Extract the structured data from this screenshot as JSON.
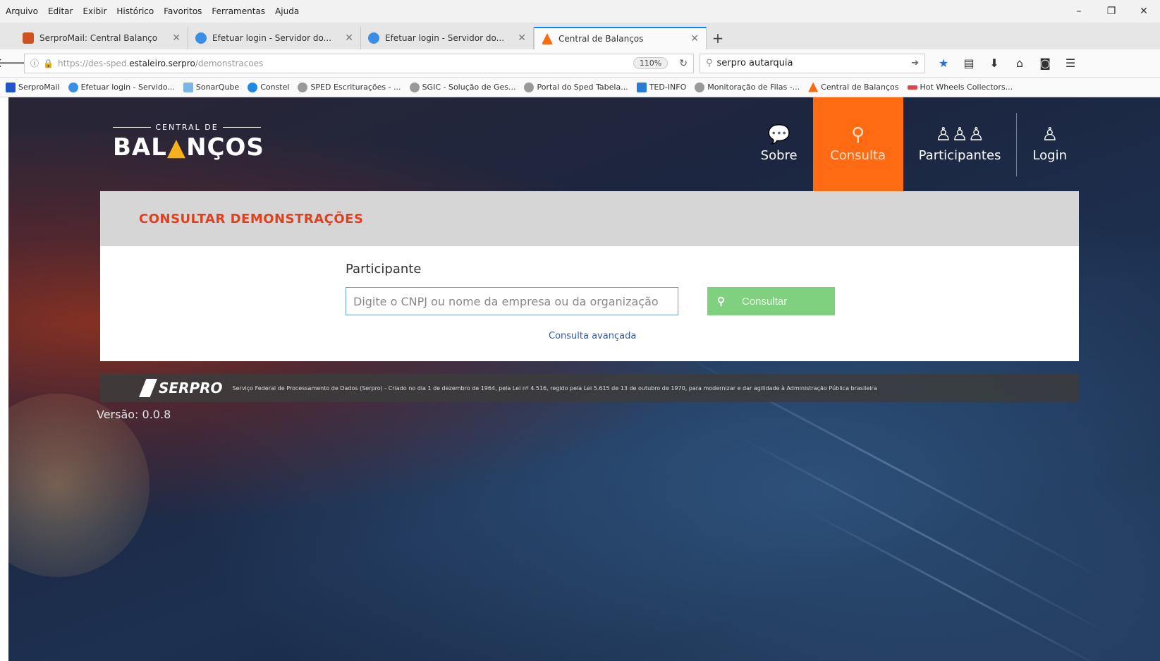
{
  "menubar": {
    "items": [
      "Arquivo",
      "Editar",
      "Exibir",
      "Histórico",
      "Favoritos",
      "Ferramentas",
      "Ajuda"
    ],
    "window_controls": [
      "–",
      "❐",
      "✕"
    ]
  },
  "tabs": [
    {
      "title": "SerproMail: Central Balanço",
      "color": "#d05020"
    },
    {
      "title": "Efetuar login - Servidor do...",
      "color": "#3a8ee6"
    },
    {
      "title": "Efetuar login - Servidor do...",
      "color": "#3a8ee6"
    },
    {
      "title": "Central de Balanços",
      "color": "#ff6b13",
      "active": true
    }
  ],
  "navbar": {
    "url_prefix": "https://des-sped.",
    "url_host": "estaleiro.serpro",
    "url_path": "/demonstracoes",
    "zoom": "110%",
    "search_value": "serpro autarquia"
  },
  "bookmarks": [
    "SerproMail",
    "Efetuar login - Servido...",
    "SonarQube",
    "Constel",
    "SPED Escriturações - ...",
    "SGIC - Solução de Ges...",
    "Portal do Sped Tabela...",
    "TED-INFO",
    "Monitoração de Filas -...",
    "Central de Balanços",
    "Hot Wheels Collectors..."
  ],
  "site": {
    "logo_top": "CENTRAL DE",
    "logo_main_a": "BAL",
    "logo_main_b": "NÇOS",
    "nav": [
      {
        "label": "Sobre",
        "icon": "💬"
      },
      {
        "label": "Consulta",
        "icon": "⚲",
        "active": true
      },
      {
        "label": "Participantes",
        "icon": "♙♙♙"
      },
      {
        "label": "Login",
        "icon": "♙"
      }
    ],
    "accent": "#ff6b13"
  },
  "card": {
    "title": "CONSULTAR DEMONSTRAÇÕES",
    "field_label": "Participante",
    "placeholder": "Digite o CNPJ ou nome da empresa ou da organização",
    "button_label": "Consultar",
    "advanced_link": "Consulta avançada"
  },
  "footer": {
    "brand": "SERPRO",
    "text": "Serviço Federal de Processamento de Dados (Serpro) - Criado no dia 1 de dezembro de 1964, pela Lei nº 4.516, regido pela Lei 5.615 de 13 de outubro de 1970, para modernizar e dar agilidade à Administração Pública brasileira",
    "version": "Versão: 0.0.8"
  }
}
